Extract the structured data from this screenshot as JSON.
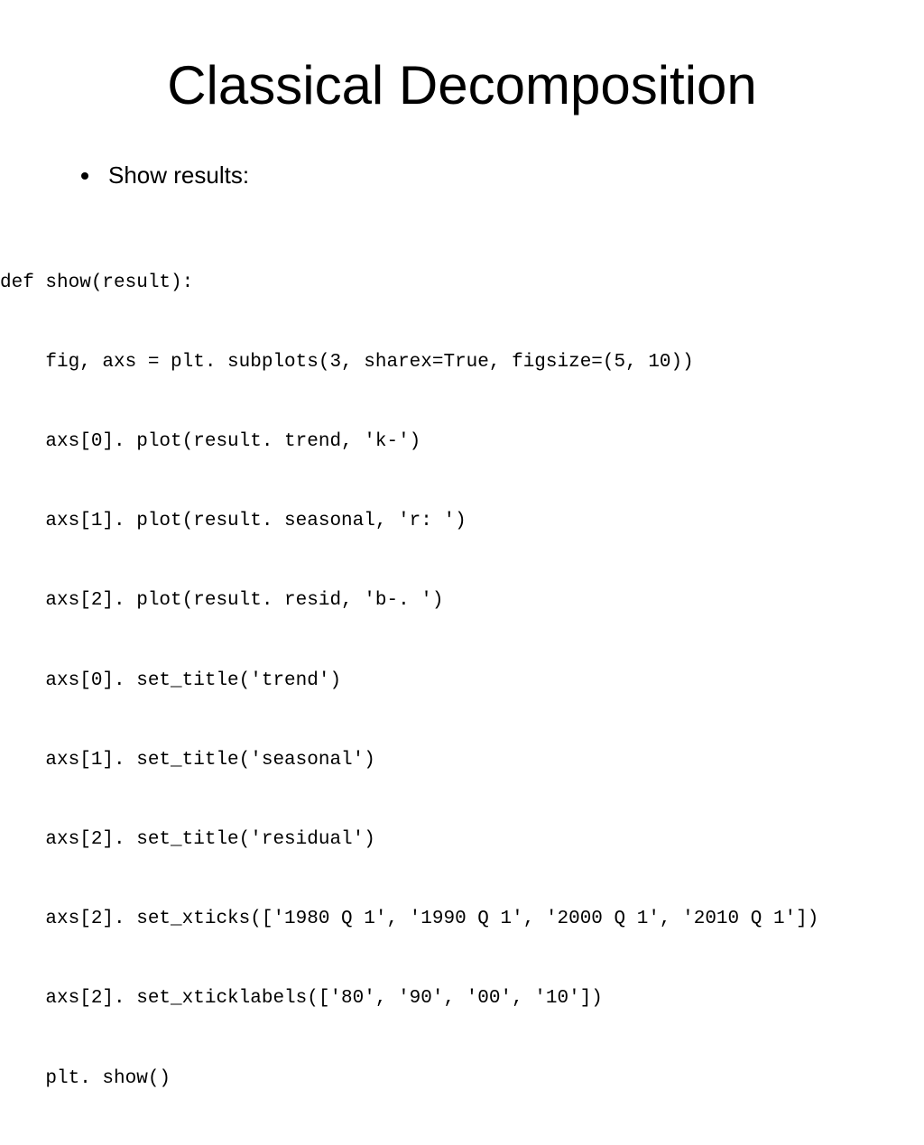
{
  "title": "Classical Decomposition",
  "bullet": "Show results:",
  "code": {
    "l1": "def show(result):",
    "l2": "    fig, axs = plt. subplots(3, sharex=True, figsize=(5, 10))",
    "l3": "    axs[0]. plot(result. trend, 'k-')",
    "l4": "    axs[1]. plot(result. seasonal, 'r: ')",
    "l5": "    axs[2]. plot(result. resid, 'b-. ')",
    "l6": "    axs[0]. set_title('trend')",
    "l7": "    axs[1]. set_title('seasonal')",
    "l8": "    axs[2]. set_title('residual')",
    "l9": "    axs[2]. set_xticks(['1980 Q 1', '1990 Q 1', '2000 Q 1', '2010 Q 1'])",
    "l10": "    axs[2]. set_xticklabels(['80', '90', '00', '10'])",
    "l11": "    plt. show()"
  }
}
